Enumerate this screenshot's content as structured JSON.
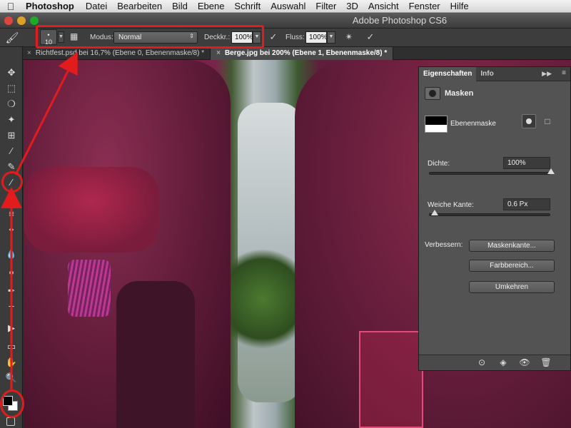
{
  "menubar": {
    "app": "Photoshop",
    "items": [
      "Datei",
      "Bearbeiten",
      "Bild",
      "Ebene",
      "Schrift",
      "Auswahl",
      "Filter",
      "3D",
      "Ansicht",
      "Fenster",
      "Hilfe"
    ]
  },
  "window": {
    "title": "Adobe Photoshop CS6"
  },
  "options": {
    "brush_size": "10",
    "modus_label": "Modus:",
    "modus_value": "Normal",
    "deckkr_label": "Deckkr.:",
    "deckkr_value": "100%",
    "fluss_label": "Fluss:",
    "fluss_value": "100%"
  },
  "tabs": [
    {
      "label": "Richtfest.psd bei 16,7% (Ebene 0, Ebenenmaske/8) *",
      "active": false
    },
    {
      "label": "Berge.jpg bei 200% (Ebene 1, Ebenenmaske/8) *",
      "active": true
    }
  ],
  "panel": {
    "tabs": [
      "Eigenschaften",
      "Info"
    ],
    "section": "Masken",
    "layer_mask_label": "Ebenenmaske",
    "dichte_label": "Dichte:",
    "dichte_value": "100%",
    "dichte_level": 1.0,
    "weiche_label": "Weiche Kante:",
    "weiche_value": "0.6 Px",
    "weiche_level": 0.01,
    "verbessern_label": "Verbessern:",
    "btn_maskenkante": "Maskenkante...",
    "btn_farbbereich": "Farbbereich...",
    "btn_umkehren": "Umkehren"
  },
  "colors": {
    "annotation": "#e21c1c",
    "foreground": "#000000",
    "background": "#ffffff"
  }
}
